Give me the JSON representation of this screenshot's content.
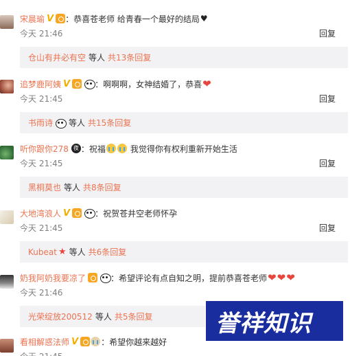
{
  "comments": [
    {
      "user": "宋晨瑜",
      "text": "：恭喜苍老师 给青春一个最好的结局",
      "time": "今天 21:46",
      "reply": "回复",
      "sub": {
        "user": "仓山有井必有空",
        "etc": "等人",
        "count": "共13条回复"
      }
    },
    {
      "user": "追梦鹿阿姨",
      "text": "：啊啊啊，女神结婚了，恭喜",
      "time": "今天 21:45",
      "reply": "回复",
      "sub": {
        "user": "书雨诗",
        "etc": "等人",
        "count": "共15条回复"
      }
    },
    {
      "user": "听你跟你278",
      "text1": "：祝福",
      "text2": "我觉得你有权利重新开始生活",
      "time": "今天 21:45",
      "reply": "回复",
      "ye_badge": "夜",
      "sub": {
        "user": "黑桐莫也",
        "etc": "等人",
        "count": "共8条回复"
      }
    },
    {
      "user": "大地湾浪人",
      "text": "：祝贺苍井空老师怀孕",
      "time": "今天 21:45",
      "reply": "回复",
      "sub": {
        "user": "Kubeat",
        "etc": "等人",
        "count": "共6条回复"
      }
    },
    {
      "user": "奶我阿奶我要凉了",
      "text": "：希望评论有点自知之明，提前恭喜苍老师",
      "time": "今天 21:46",
      "reply": "回复",
      "sub": {
        "user": "光荣绽放200512",
        "etc": "等人",
        "count": "共5条回复"
      }
    },
    {
      "user": "看相解惑法师",
      "text": "：希望你越来越好",
      "time": "今天 21:45"
    }
  ],
  "watermark": {
    "text": "誉祥知识"
  },
  "icons": [
    "v-badge",
    "level-badge",
    "panda-emoji",
    "heart-emoji",
    "cry-emoji",
    "star-icon"
  ],
  "colors": {
    "username": "#eb7350",
    "time": "#808080",
    "reply_box": "#f2f2f5",
    "watermark_bg": "#1a2d9e"
  }
}
